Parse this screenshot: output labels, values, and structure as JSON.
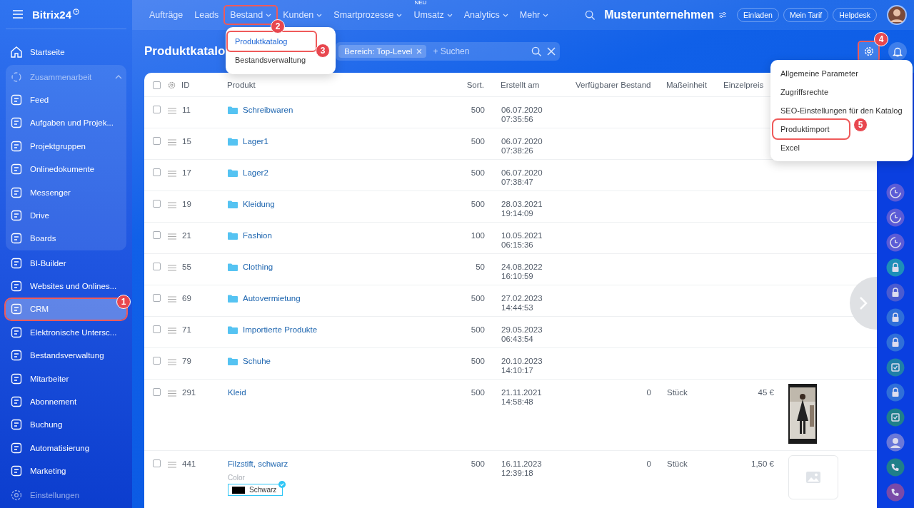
{
  "logo": {
    "text": "Bitrix24"
  },
  "sidebar": {
    "top": [
      {
        "label": "Startseite"
      }
    ],
    "group": {
      "label": "Zusammenarbeit",
      "expanded": true,
      "items": [
        {
          "label": "Feed"
        },
        {
          "label": "Aufgaben und Projek..."
        },
        {
          "label": "Projektgruppen"
        },
        {
          "label": "Onlinedokumente"
        },
        {
          "label": "Messenger"
        },
        {
          "label": "Drive"
        },
        {
          "label": "Boards"
        }
      ]
    },
    "items": [
      {
        "label": "BI-Builder",
        "selected": false
      },
      {
        "label": "Websites und Onlines...",
        "selected": false
      },
      {
        "label": "CRM",
        "selected": true,
        "callout": "1"
      },
      {
        "label": "Elektronische Untersc...",
        "selected": false
      },
      {
        "label": "Bestandsverwaltung",
        "selected": false
      },
      {
        "label": "Mitarbeiter",
        "selected": false
      },
      {
        "label": "Abonnement",
        "selected": false
      },
      {
        "label": "Buchung",
        "selected": false
      },
      {
        "label": "Automatisierung",
        "selected": false
      },
      {
        "label": "Marketing",
        "selected": false
      }
    ],
    "footer": {
      "label": "Einstellungen"
    }
  },
  "nav": [
    {
      "label": "Aufträge",
      "dropdown": false
    },
    {
      "label": "Leads",
      "dropdown": false
    },
    {
      "label": "Bestand",
      "dropdown": true,
      "callout": "2"
    },
    {
      "label": "Kunden",
      "dropdown": true
    },
    {
      "label": "Smartprozesse",
      "dropdown": true
    },
    {
      "label": "Umsatz",
      "dropdown": true,
      "badge": "NEU"
    },
    {
      "label": "Analytics",
      "dropdown": true
    },
    {
      "label": "Mehr",
      "dropdown": true
    }
  ],
  "company": "Musterunternehmen",
  "header_buttons": [
    "Einladen",
    "Mein Tarif",
    "Helpdesk"
  ],
  "nav_menu": [
    {
      "label": "Produktkatalog",
      "selected": true,
      "callout": "3"
    },
    {
      "label": "Bestandsverwaltung",
      "selected": false
    }
  ],
  "page_title": "Produktkatalo",
  "filter": {
    "chip": "Bereich: Top-Level",
    "placeholder": "+ Suchen"
  },
  "settings_button": {
    "callout": "4"
  },
  "settings_menu": [
    {
      "label": "Allgemeine Parameter"
    },
    {
      "label": "Zugriffsrechte"
    },
    {
      "label": "SEO-Einstellungen für den Katalog"
    },
    {
      "label": "Produktimport",
      "callout": "5"
    },
    {
      "label": "Excel"
    }
  ],
  "table": {
    "all_checked": false,
    "columns": [
      "ID",
      "Produkt",
      "Sort.",
      "Erstellt am",
      "Verfügbarer Bestand",
      "Maßeinheit",
      "Einzelpreis"
    ],
    "rows": [
      {
        "checked": false,
        "id": "11",
        "kind": "folder",
        "name": "Schreibwaren",
        "sort": "500",
        "date": "06.07.2020",
        "time": "07:35:56"
      },
      {
        "checked": false,
        "id": "15",
        "kind": "folder",
        "name": "Lager1",
        "sort": "500",
        "date": "06.07.2020",
        "time": "07:38:26"
      },
      {
        "checked": false,
        "id": "17",
        "kind": "folder",
        "name": "Lager2",
        "sort": "500",
        "date": "06.07.2020",
        "time": "07:38:47"
      },
      {
        "checked": false,
        "id": "19",
        "kind": "folder",
        "name": "Kleidung",
        "sort": "500",
        "date": "28.03.2021",
        "time": "19:14:09"
      },
      {
        "checked": false,
        "id": "21",
        "kind": "folder",
        "name": "Fashion",
        "sort": "100",
        "date": "10.05.2021",
        "time": "06:15:36"
      },
      {
        "checked": false,
        "id": "55",
        "kind": "folder",
        "name": "Clothing",
        "sort": "50",
        "date": "24.08.2022",
        "time": "16:10:59"
      },
      {
        "checked": false,
        "id": "69",
        "kind": "folder",
        "name": "Autovermietung",
        "sort": "500",
        "date": "27.02.2023",
        "time": "14:44:53"
      },
      {
        "checked": false,
        "id": "71",
        "kind": "folder",
        "name": "Importierte Produkte",
        "sort": "500",
        "date": "29.05.2023",
        "time": "06:43:54"
      },
      {
        "checked": false,
        "id": "79",
        "kind": "folder",
        "name": "Schuhe",
        "sort": "500",
        "date": "20.10.2023",
        "time": "14:10:17"
      },
      {
        "checked": false,
        "id": "291",
        "kind": "pictured",
        "name": "Kleid",
        "sort": "500",
        "date": "21.11.2021",
        "time": "14:58:48",
        "stock": "0",
        "unit": "Stück",
        "price": "45 €"
      },
      {
        "checked": false,
        "id": "441",
        "kind": "product",
        "name": "Filzstift, schwarz",
        "sort": "500",
        "date": "16.11.2023",
        "time": "12:39:18",
        "stock": "0",
        "unit": "Stück",
        "price": "1,50 €",
        "variant": {
          "label": "Color",
          "value": "Schwarz"
        }
      }
    ]
  }
}
